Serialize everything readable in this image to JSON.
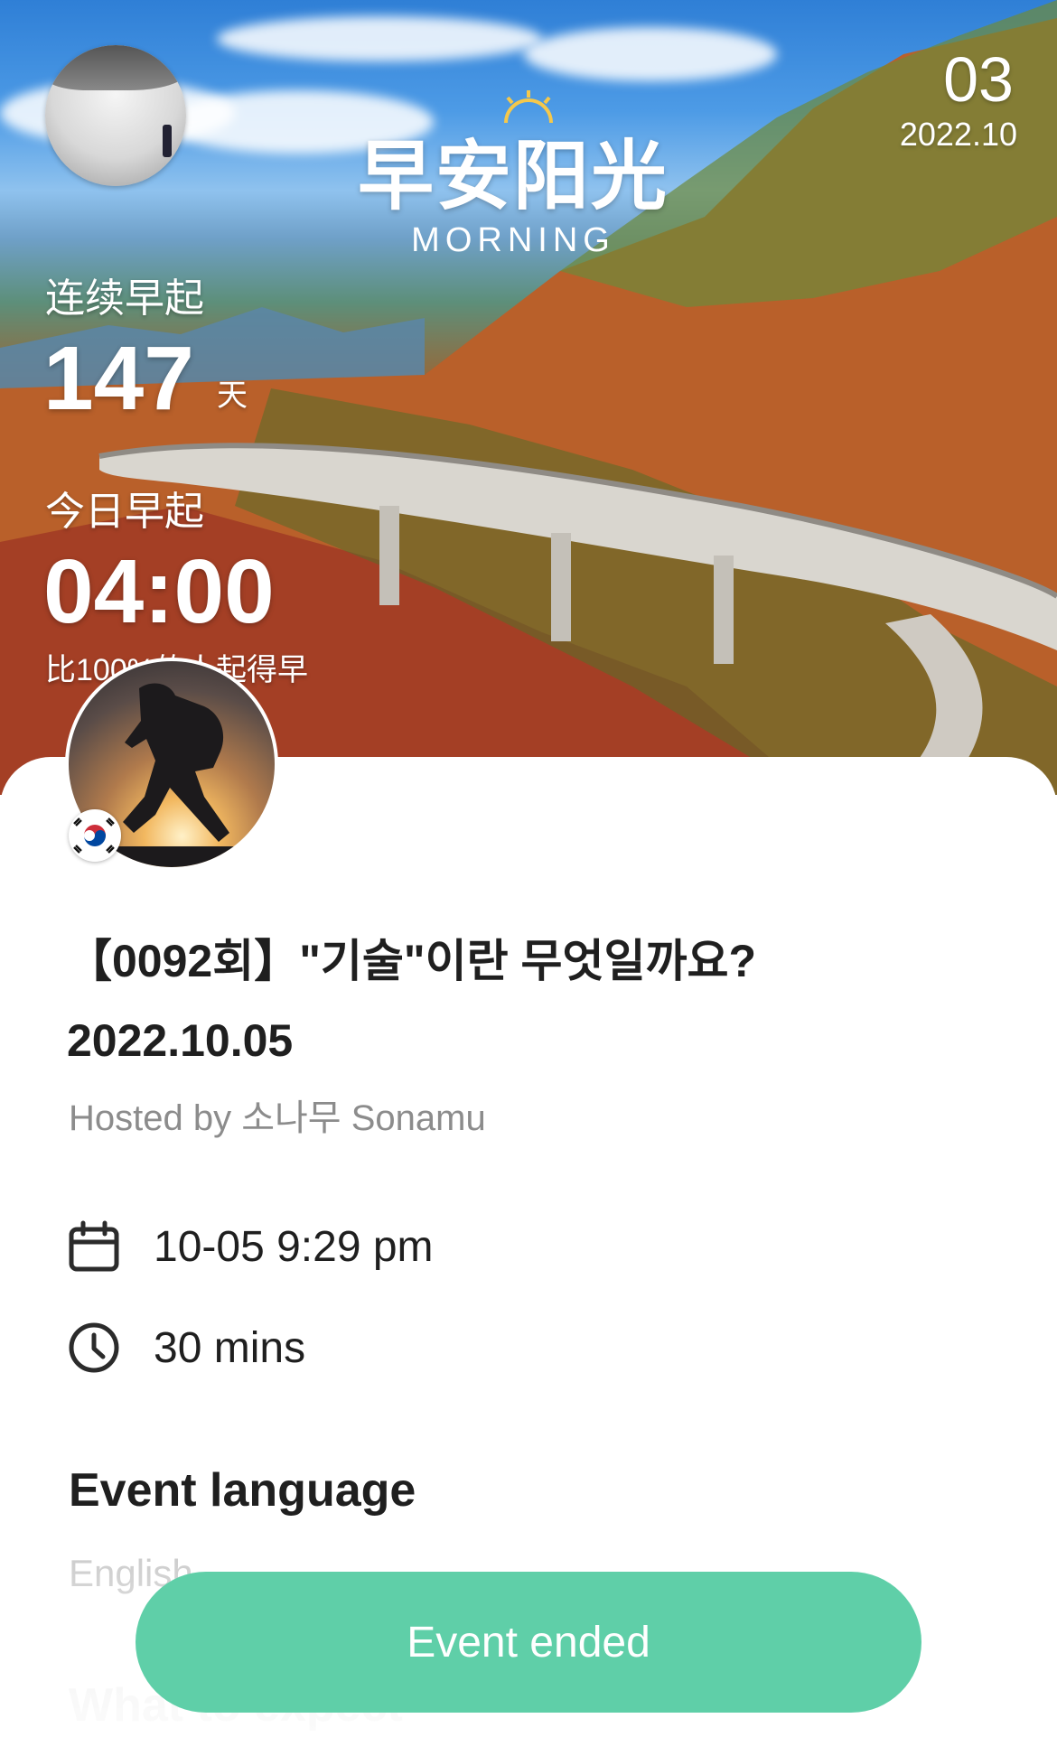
{
  "hero": {
    "brand_title": "早安阳光",
    "brand_subtitle": "MORNING",
    "day": "03",
    "month": "2022.10",
    "streak_label": "连续早起",
    "streak_days": "147",
    "streak_unit": "天",
    "today_label": "今日早起",
    "today_time": "04:00",
    "compare_text": "比100%的人起得早"
  },
  "event": {
    "title_line1": "【0092회】\"기술\"이란 무엇일까요?",
    "title_line2": "2022.10.05",
    "host_line": "Hosted by 소나무 Sonamu",
    "datetime": "10-05 9:29 pm",
    "duration": "30 mins",
    "language_heading": "Event language",
    "language_value": "English",
    "expect_heading": "What to expect",
    "status_button": "Event ended"
  },
  "colors": {
    "accent_button": "#5fcfa8",
    "text_primary": "#1f1f1f",
    "text_secondary": "#8c8c8c"
  },
  "icons": {
    "date": "calendar-icon",
    "duration": "clock-icon",
    "flag": "south-korea-flag-icon"
  }
}
